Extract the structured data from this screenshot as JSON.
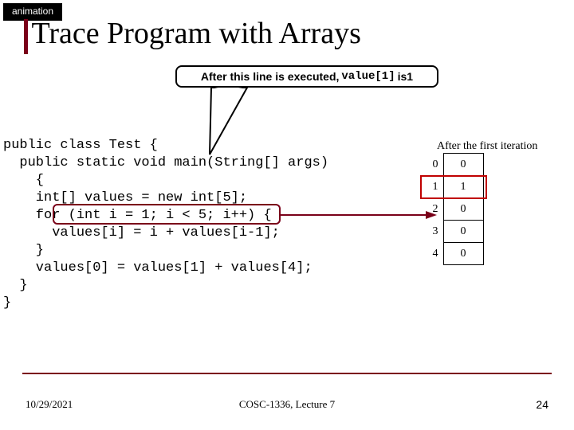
{
  "tag": "animation",
  "title": "Trace Program with Arrays",
  "callout": {
    "prefix": "After this line is executed, ",
    "code": "value[1]",
    "mid": " is ",
    "val": "1"
  },
  "code_lines": [
    "public class Test {",
    "  public static void main(String[] args)",
    "    {",
    "    int[] values = new int[5];",
    "    for (int i = 1; i < 5; i++) {",
    "      values[i] = i + values[i-1];",
    "    }",
    "    values[0] = values[1] + values[4];",
    "  }",
    "}"
  ],
  "diagram": {
    "caption": "After the first iteration",
    "rows": [
      {
        "idx": "0",
        "val": "0"
      },
      {
        "idx": "1",
        "val": "1"
      },
      {
        "idx": "2",
        "val": "0"
      },
      {
        "idx": "3",
        "val": "0"
      },
      {
        "idx": "4",
        "val": "0"
      }
    ],
    "highlight_row": 1
  },
  "footer": {
    "date": "10/29/2021",
    "course": "COSC-1336, Lecture 7",
    "page": "24"
  }
}
